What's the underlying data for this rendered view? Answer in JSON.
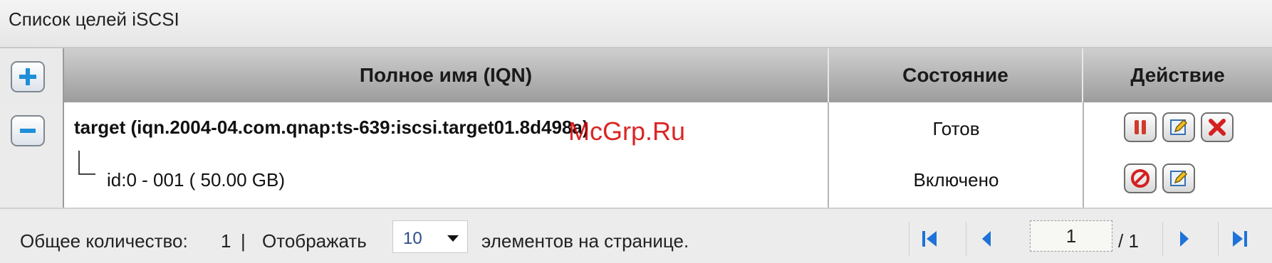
{
  "panel": {
    "title": "Список целей iSCSI"
  },
  "table": {
    "columns": [
      "Полное имя (IQN)",
      "Состояние",
      "Действие"
    ],
    "rows": [
      {
        "name": "target (iqn.2004-04.com.qnap:ts-639:iscsi.target01.8d498a)",
        "status": "Готов"
      },
      {
        "name": "id:0 - 001 ( 50.00 GB)",
        "status": "Включено"
      }
    ]
  },
  "watermark": "McGrp.Ru",
  "footer": {
    "total_label": "Общее количество:",
    "total_value": "1",
    "separator": "|",
    "show_label": "Отображать",
    "per_page_value": "10",
    "per_page_suffix": "элементов на странице.",
    "current_page": "1",
    "total_pages": "/ 1"
  },
  "colors": {
    "add_icon": "#1e8fd8",
    "stop_icon": "#d23a2a",
    "delete_icon": "#d42020",
    "nav_arrow": "#1e72d8"
  }
}
